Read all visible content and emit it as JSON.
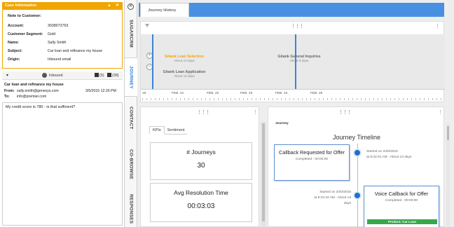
{
  "case": {
    "header": "Case Information",
    "collapse_glyph": "▲",
    "close_glyph": "✕",
    "note_title": "Note to Customer:",
    "fields": [
      {
        "key": "Account:",
        "value": "3038073763"
      },
      {
        "key": "Customer Segment:",
        "value": "Gold"
      },
      {
        "key": "Name:",
        "value": "Sally Smith"
      },
      {
        "key": "Subject:",
        "value": "Car loan and refinance my house"
      },
      {
        "key": "Origin:",
        "value": "Inbound email"
      }
    ]
  },
  "interaction": {
    "caret": "▾",
    "type": "Inbound",
    "attachments": "(5)",
    "contacts": "(39)"
  },
  "email": {
    "subject": "Car loan and refinance my house",
    "from_label": "From:",
    "from": "sally.smith@genesys.com",
    "to_label": "To:",
    "to": "info@premier.com",
    "date": "3/5/2015 12:26 PM",
    "body": "My credit score is 780 - is that sufficient?"
  },
  "vtabs": {
    "close": "✕",
    "items": [
      {
        "label": "SUGARCRM"
      },
      {
        "label": "JOURNEY"
      },
      {
        "label": "CONTACT"
      },
      {
        "label": "CO-BROWSE"
      },
      {
        "label": "RESPONSES"
      }
    ]
  },
  "main": {
    "tab_label": "Journey History",
    "grip": "⋮⋮⋮",
    "kebab": "⋮",
    "zoom_in": "+",
    "zoom_out": "−",
    "events": [
      {
        "title": "Gitank Loan Selection",
        "sub": "About 13 days"
      },
      {
        "title": "Gitank Loan Application",
        "sub": "About 13 days"
      },
      {
        "title": "Gitank General Inquiries",
        "sub": "About 9 days"
      }
    ],
    "axis_labels": [
      "19",
      "FEB. 21",
      "FEB. 22",
      "FEB. 23",
      "FEB. 24",
      "FEB. 25"
    ]
  },
  "kpi": {
    "tabs": [
      "KPIs",
      "Sentiment"
    ],
    "cards": [
      {
        "label": "# Journeys",
        "value": "30"
      },
      {
        "label": "Avg Resolution Time",
        "value": "00:03:03"
      }
    ]
  },
  "journey": {
    "label": "Journey",
    "title": "Journey Timeline",
    "items": [
      {
        "title": "Callback Requested for Offer",
        "status": "Completed - 00:00:00",
        "started": "Started on 2/20/2015",
        "time": "at 9:22:01 AM - About 13 days"
      },
      {
        "title": "Voice Callback for Offer",
        "status": "Completed - 00:00:00",
        "started": "Started on 2/20/2015",
        "time": "at 9:22:24 AM - About 13 days",
        "product": "Product: Car Loan"
      }
    ]
  },
  "colors": {
    "accent": "#f0a500",
    "tab_blue": "#4a90e2",
    "timeline_blue": "#3b82d6",
    "product_green": "#3aa64b"
  }
}
